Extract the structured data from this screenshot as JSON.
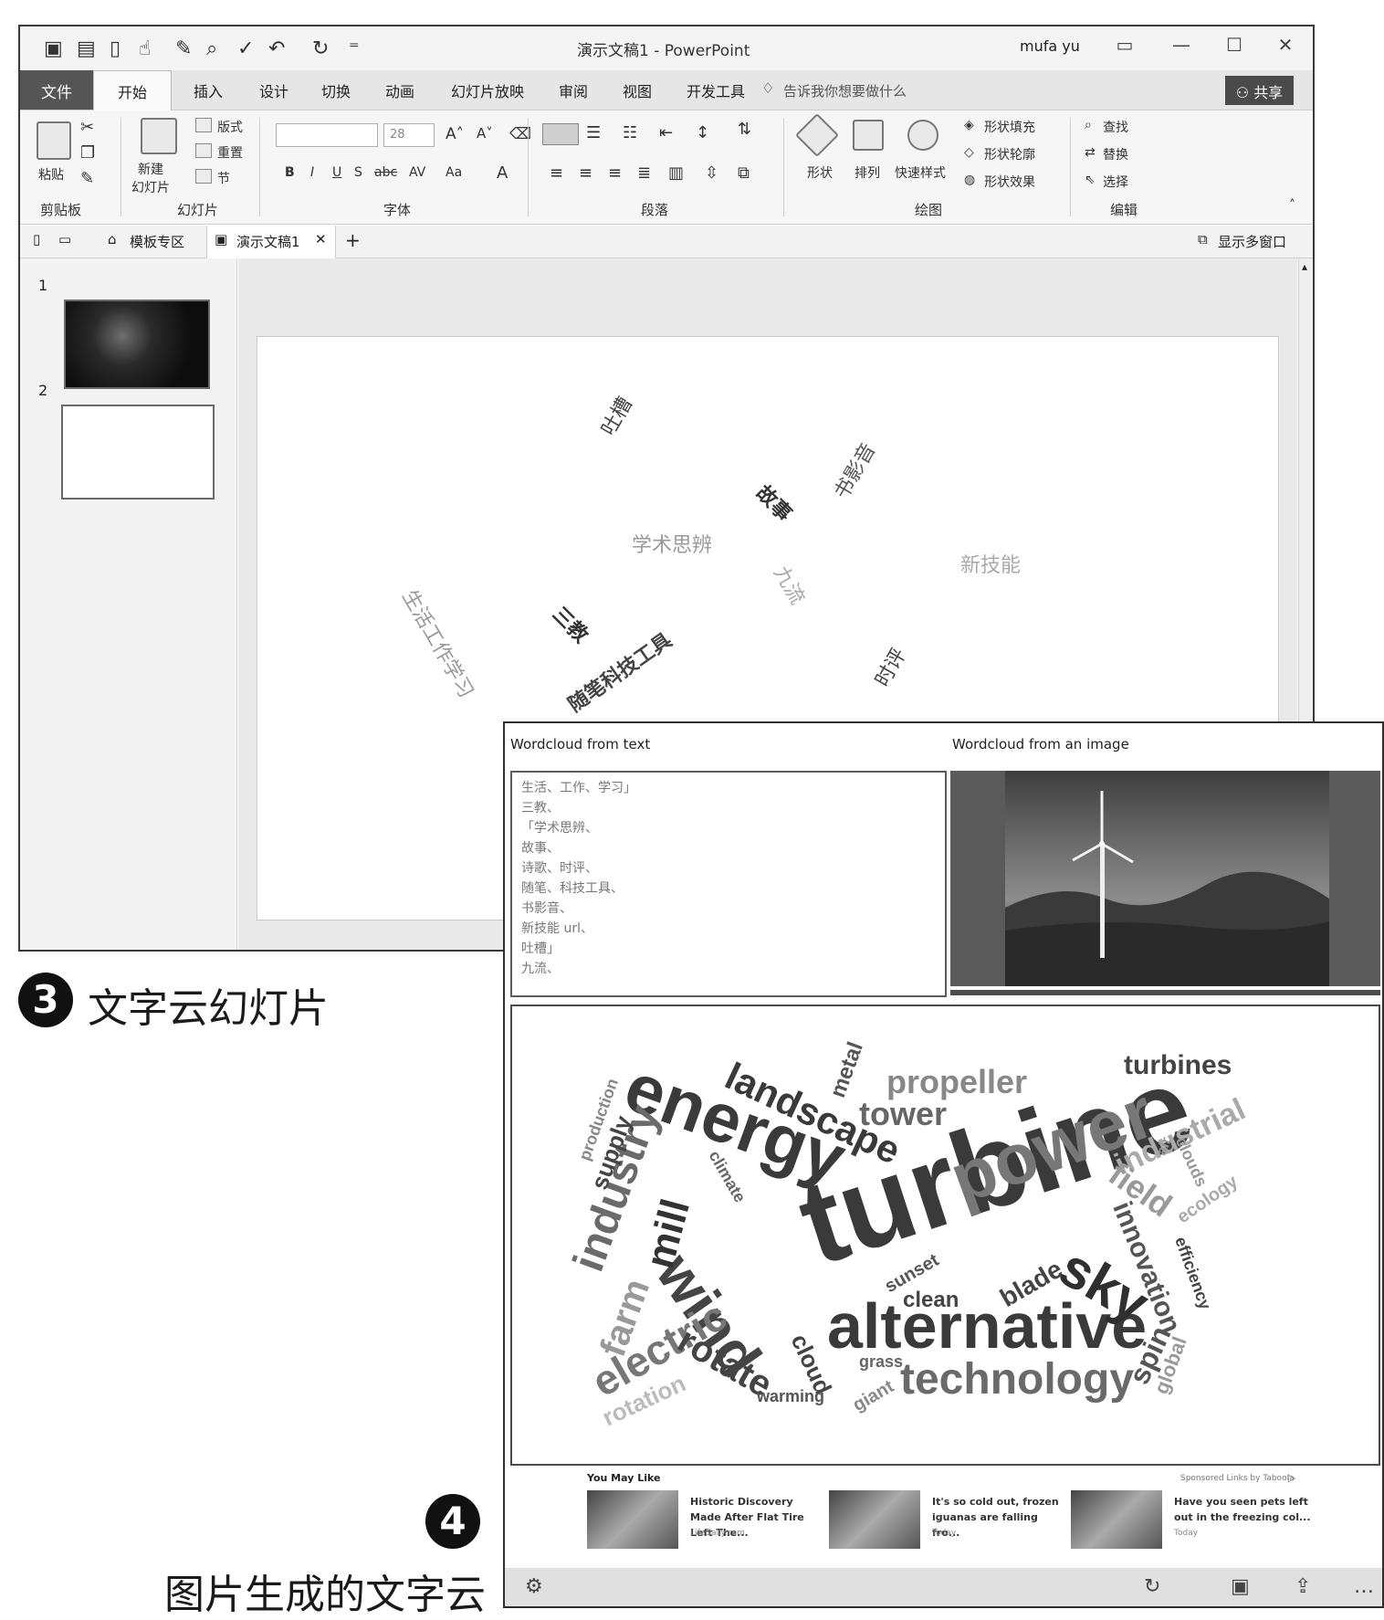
{
  "ppt": {
    "doc_title": "演示文稿1 - PowerPoint",
    "user_name": "mufa yu",
    "tabs": [
      "文件",
      "开始",
      "插入",
      "设计",
      "切换",
      "动画",
      "幻灯片放映",
      "审阅",
      "视图",
      "开发工具"
    ],
    "tell_me": "告诉我你想要做什么",
    "share": "共享",
    "ribbon": {
      "paste": "粘贴",
      "clipboard": "剪贴板",
      "new_slide": "新建\n幻灯片",
      "layout": "版式",
      "reset": "重置",
      "section": "节",
      "slides": "幻灯片",
      "font_size": "28",
      "font": "字体",
      "paragraph": "段落",
      "shape": "形状",
      "arrange": "排列",
      "quick_styles": "快速样式",
      "shape_fill": "形状填充",
      "shape_outline": "形状轮廓",
      "shape_effects": "形状效果",
      "drawing": "绘图",
      "find": "查找",
      "replace": "替换",
      "select": "选择",
      "editing": "编辑"
    },
    "doc_tabs": {
      "template": "模板专区",
      "doc": "演示文稿1",
      "multi_window": "显示多窗口"
    },
    "slide_numbers": [
      "1",
      "2"
    ],
    "slide_words": [
      {
        "text": "吐槽",
        "color": "#444"
      },
      {
        "text": "书影音",
        "color": "#555"
      },
      {
        "text": "故事",
        "color": "#333"
      },
      {
        "text": "学术思辨",
        "color": "#999"
      },
      {
        "text": "新技能",
        "color": "#aaa"
      },
      {
        "text": "九流",
        "color": "#aaa"
      },
      {
        "text": "生活工作学习",
        "color": "#999"
      },
      {
        "text": "三教",
        "color": "#333"
      },
      {
        "text": "随笔科技工具",
        "color": "#444"
      },
      {
        "text": "时评",
        "color": "#444"
      }
    ]
  },
  "captions": {
    "c3_num": "3",
    "c3_text": "文字云幻灯片",
    "c4_num": "4",
    "c4_text": "图片生成的文字云"
  },
  "wordcloud_app": {
    "text_header": "Wordcloud from text",
    "image_header": "Wordcloud from an image",
    "text_lines": [
      "生活、工作、学习」",
      "三教、",
      "「学术思辨、",
      "故事、",
      "诗歌、时评、",
      "随笔、科技工具、",
      "书影音、",
      "新技能 url、",
      "吐槽」",
      "九流、"
    ],
    "words": [
      {
        "text": "turbine",
        "color": "#3a3a3a"
      },
      {
        "text": "energy",
        "color": "#3a3a3a"
      },
      {
        "text": "power",
        "color": "#777777"
      },
      {
        "text": "alternative",
        "color": "#3a3a3a"
      },
      {
        "text": "wind",
        "color": "#444444"
      },
      {
        "text": "technology",
        "color": "#6a6a6a"
      },
      {
        "text": "industry",
        "color": "#6a6a6a"
      },
      {
        "text": "sky",
        "color": "#2f2f2f"
      },
      {
        "text": "landscape",
        "color": "#3a3a3a"
      },
      {
        "text": "electric",
        "color": "#777777"
      },
      {
        "text": "mill",
        "color": "#333333"
      },
      {
        "text": "propeller",
        "color": "#888888"
      },
      {
        "text": "tower",
        "color": "#666666"
      },
      {
        "text": "turbines",
        "color": "#444444"
      },
      {
        "text": "industrial",
        "color": "#aaaaaa"
      },
      {
        "text": "field",
        "color": "#999999"
      },
      {
        "text": "innovation",
        "color": "#555555"
      },
      {
        "text": "rotate",
        "color": "#444444"
      },
      {
        "text": "farm",
        "color": "#999999"
      },
      {
        "text": "supply",
        "color": "#444444"
      },
      {
        "text": "production",
        "color": "#888888"
      },
      {
        "text": "metal",
        "color": "#555555"
      },
      {
        "text": "climate",
        "color": "#666666"
      },
      {
        "text": "sunset",
        "color": "#555555"
      },
      {
        "text": "clean",
        "color": "#444444"
      },
      {
        "text": "blade",
        "color": "#444444"
      },
      {
        "text": "spin",
        "color": "#555555"
      },
      {
        "text": "global",
        "color": "#999999"
      },
      {
        "text": "ecology",
        "color": "#aaaaaa"
      },
      {
        "text": "efficiency",
        "color": "#444444"
      },
      {
        "text": "clouds",
        "color": "#999999"
      },
      {
        "text": "air",
        "color": "#999999"
      },
      {
        "text": "cloud",
        "color": "#444444"
      },
      {
        "text": "grass",
        "color": "#666666"
      },
      {
        "text": "giant",
        "color": "#888888"
      },
      {
        "text": "warming",
        "color": "#555555"
      },
      {
        "text": "rotation",
        "color": "#bbbbbb"
      }
    ],
    "ads": {
      "header": "You May Like",
      "sponsor": "Sponsored Links by Taboola",
      "items": [
        {
          "title": "Historic Discovery Made After Flat Tire Left The...",
          "meta": "LifeDaily.com"
        },
        {
          "title": "It's so cold out, frozen iguanas are falling fro...",
          "meta": "Today"
        },
        {
          "title": "Have you seen pets left out in the freezing col...",
          "meta": "Today"
        }
      ]
    }
  }
}
